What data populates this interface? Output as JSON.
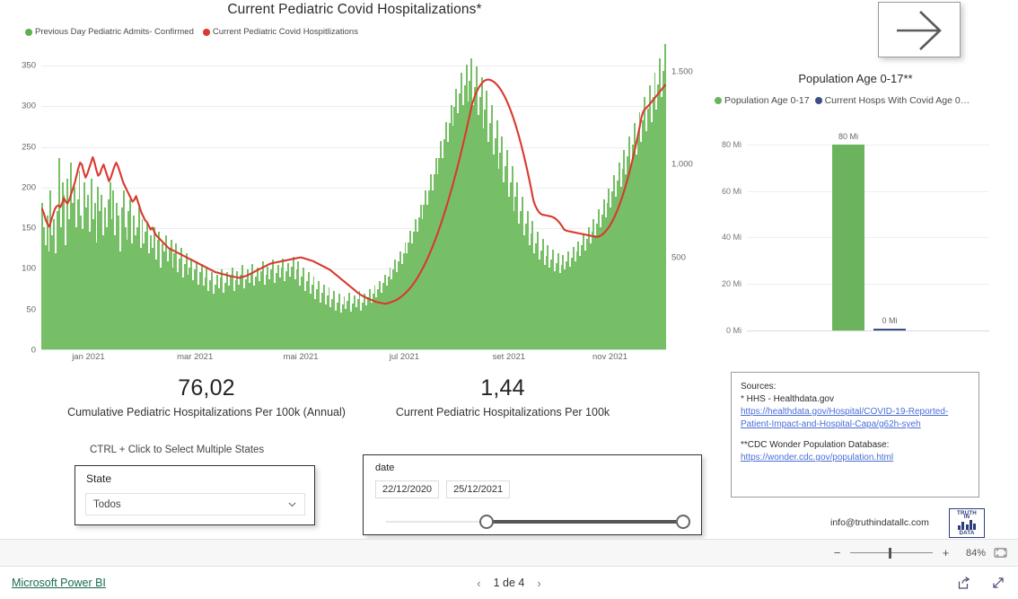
{
  "main_chart": {
    "title": "Current Pediatric Covid Hospitalizations*",
    "legend": [
      {
        "label": "Previous Day Pediatric Admits- Confirmed",
        "color": "#5ead4e"
      },
      {
        "label": "Current Pediatric Covid Hospitlizations",
        "color": "#d9392f"
      }
    ]
  },
  "kpi1": {
    "value": "76,02",
    "label": "Cumulative Pediatric Hospitalizations Per 100k (Annual)"
  },
  "kpi2": {
    "value": "1,44",
    "label": "Current Pediatric Hospitalizations Per 100k"
  },
  "state_slicer": {
    "hint": "CTRL + Click to Select Multiple States",
    "title": "State",
    "value": "Todos"
  },
  "date_slicer": {
    "title": "date",
    "start": "22/12/2020",
    "end": "25/12/2021"
  },
  "population_chart": {
    "title": "Population Age 0-17**",
    "legend": [
      {
        "label": "Population Age 0-17",
        "color": "#6cb35e"
      },
      {
        "label": "Current Hosps With Covid Age 0…",
        "color": "#3b4e87"
      }
    ]
  },
  "sources": {
    "heading": "Sources:",
    "line1": "* HHS - Healthdata.gov",
    "link1a": "https://healthdata.gov/Hospital/COVID-19-Reported-",
    "link1b": "Patient-Impact-and-Hospital-Capa/g62h-syeh",
    "line2": "**CDC Wonder Population Database:",
    "link2": "https://wonder.cdc.gov/population.html"
  },
  "footer": {
    "contact": "info@truthindatallc.com",
    "logo_top": "TRUTH",
    "logo_mid": "IN",
    "logo_bottom": "DATA"
  },
  "zoombar": {
    "minus": "−",
    "plus": "+",
    "percent": "84%"
  },
  "statusbar": {
    "brand": "Microsoft Power BI",
    "page": "1 de 4",
    "prev": "‹",
    "next": "›"
  },
  "chart_data": {
    "type": "bar",
    "title": "Current Pediatric Covid Hospitalizations*",
    "xlabel": "",
    "ylabel": "",
    "grid": true,
    "legend_position": "top-left",
    "xtick_labels": [
      "jan 2021",
      "mar 2021",
      "mai 2021",
      "jul 2021",
      "set 2021",
      "nov 2021"
    ],
    "xtick_positions_pct": [
      5.2,
      22.0,
      39.0,
      56.0,
      72.5,
      88.5
    ],
    "y_left": {
      "ticks": [
        0,
        50,
        100,
        150,
        200,
        250,
        300,
        350
      ],
      "range": [
        0,
        370
      ]
    },
    "y_right": {
      "ticks": [
        500,
        1000,
        1500
      ],
      "tick_labels": [
        "500",
        "1.000",
        "1.500"
      ],
      "range": [
        0,
        1620
      ]
    },
    "series": [
      {
        "name": "Previous Day Pediatric Admits- Confirmed",
        "type": "bar",
        "axis": "left",
        "color": "#77bf66",
        "values": [
          180,
          150,
          128,
          165,
          120,
          195,
          140,
          160,
          118,
          170,
          235,
          150,
          205,
          190,
          128,
          210,
          160,
          230,
          180,
          200,
          150,
          185,
          220,
          165,
          148,
          205,
          175,
          190,
          145,
          210,
          160,
          180,
          132,
          200,
          170,
          190,
          140,
          175,
          150,
          185,
          205,
          160,
          195,
          140,
          180,
          165,
          120,
          175,
          195,
          150,
          135,
          170,
          185,
          130,
          165,
          140,
          150,
          175,
          125,
          160,
          130,
          145,
          155,
          118,
          140,
          125,
          150,
          110,
          135,
          145,
          100,
          130,
          120,
          140,
          108,
          125,
          135,
          100,
          118,
          130,
          95,
          112,
          125,
          88,
          105,
          118,
          92,
          100,
          112,
          85,
          98,
          108,
          80,
          95,
          105,
          78,
          88,
          100,
          72,
          85,
          95,
          68,
          80,
          92,
          75,
          88,
          98,
          70,
          82,
          95,
          78,
          90,
          100,
          72,
          85,
          96,
          80,
          92,
          104,
          75,
          86,
          98,
          82,
          94,
          105,
          78,
          90,
          100,
          84,
          96,
          108,
          80,
          92,
          102,
          86,
          98,
          110,
          82,
          94,
          104,
          88,
          100,
          112,
          84,
          96,
          106,
          90,
          102,
          114,
          86,
          98,
          108,
          78,
          90,
          100,
          72,
          84,
          95,
          68,
          80,
          90,
          62,
          74,
          84,
          58,
          70,
          80,
          55,
          66,
          76,
          52,
          62,
          72,
          48,
          58,
          68,
          45,
          55,
          65,
          50,
          60,
          70,
          46,
          56,
          66,
          52,
          62,
          72,
          48,
          58,
          68,
          54,
          64,
          74,
          58,
          68,
          78,
          64,
          74,
          84,
          70,
          82,
          92,
          78,
          90,
          100,
          86,
          98,
          110,
          95,
          108,
          120,
          105,
          118,
          132,
          118,
          132,
          146,
          130,
          145,
          160,
          145,
          162,
          178,
          160,
          178,
          196,
          178,
          196,
          215,
          196,
          215,
          235,
          215,
          235,
          256,
          235,
          258,
          280,
          255,
          278,
          300,
          275,
          298,
          320,
          290,
          315,
          340,
          300,
          325,
          350,
          305,
          330,
          358,
          300,
          322,
          348,
          288,
          310,
          335,
          272,
          295,
          318,
          255,
          278,
          300,
          240,
          260,
          282,
          222,
          242,
          262,
          205,
          225,
          245,
          188,
          205,
          225,
          170,
          188,
          205,
          155,
          170,
          188,
          140,
          155,
          170,
          128,
          142,
          158,
          118,
          130,
          145,
          110,
          122,
          136,
          104,
          115,
          128,
          100,
          110,
          123,
          96,
          106,
          118,
          94,
          104,
          116,
          98,
          108,
          120,
          102,
          113,
          126,
          108,
          120,
          133,
          115,
          128,
          142,
          122,
          136,
          150,
          130,
          145,
          160,
          140,
          155,
          172,
          150,
          166,
          184,
          162,
          180,
          198,
          175,
          194,
          214,
          188,
          208,
          230,
          200,
          222,
          245,
          215,
          238,
          262,
          228,
          252,
          278,
          240,
          266,
          292,
          255,
          282,
          310,
          268,
          296,
          325,
          280,
          310,
          340,
          295,
          326,
          358,
          310,
          342,
          376
        ]
      },
      {
        "name": "Current Pediatric Covid Hospitlizations",
        "type": "line",
        "axis": "right",
        "color": "#d9392f",
        "values": [
          760,
          735,
          700,
          680,
          665,
          700,
          730,
          760,
          775,
          780,
          770,
          790,
          820,
          800,
          790,
          810,
          840,
          870,
          900,
          940,
          980,
          1010,
          1000,
          960,
          930,
          950,
          980,
          1010,
          1040,
          1010,
          970,
          940,
          950,
          980,
          1000,
          970,
          940,
          910,
          930,
          960,
          990,
          1010,
          990,
          960,
          930,
          900,
          880,
          860,
          840,
          820,
          800,
          810,
          830,
          800,
          770,
          740,
          720,
          700,
          690,
          670,
          650,
          660,
          640,
          620,
          610,
          600,
          590,
          580,
          570,
          560,
          550,
          545,
          540,
          535,
          530,
          525,
          520,
          515,
          510,
          505,
          500,
          495,
          490,
          485,
          480,
          475,
          470,
          465,
          460,
          455,
          450,
          445,
          440,
          435,
          430,
          425,
          420,
          418,
          415,
          412,
          410,
          408,
          405,
          402,
          400,
          398,
          396,
          394,
          392,
          390,
          392,
          395,
          398,
          400,
          405,
          410,
          415,
          420,
          425,
          430,
          435,
          440,
          445,
          450,
          455,
          460,
          465,
          468,
          470,
          472,
          474,
          476,
          478,
          480,
          482,
          484,
          486,
          488,
          490,
          492,
          494,
          496,
          498,
          500,
          498,
          495,
          492,
          489,
          486,
          483,
          480,
          475,
          470,
          465,
          460,
          455,
          450,
          445,
          440,
          435,
          428,
          420,
          412,
          404,
          396,
          388,
          380,
          372,
          364,
          356,
          348,
          340,
          332,
          324,
          316,
          308,
          300,
          295,
          290,
          285,
          280,
          276,
          272,
          268,
          264,
          260,
          258,
          256,
          254,
          252,
          250,
          252,
          255,
          258,
          262,
          266,
          270,
          276,
          282,
          290,
          298,
          306,
          316,
          326,
          338,
          350,
          364,
          378,
          394,
          410,
          428,
          446,
          466,
          486,
          508,
          530,
          554,
          578,
          604,
          630,
          658,
          686,
          716,
          746,
          778,
          810,
          844,
          878,
          914,
          950,
          988,
          1026,
          1066,
          1106,
          1148,
          1190,
          1234,
          1278,
          1324,
          1352,
          1380,
          1400,
          1418,
          1432,
          1444,
          1452,
          1456,
          1458,
          1456,
          1452,
          1446,
          1438,
          1428,
          1416,
          1402,
          1386,
          1368,
          1348,
          1326,
          1302,
          1276,
          1248,
          1218,
          1186,
          1152,
          1116,
          1078,
          1038,
          996,
          952,
          906,
          858,
          808,
          780,
          760,
          745,
          735,
          730,
          728,
          726,
          724,
          722,
          720,
          716,
          710,
          702,
          692,
          680,
          666,
          650,
          645,
          642,
          640,
          638,
          636,
          634,
          632,
          630,
          628,
          626,
          624,
          622,
          620,
          618,
          616,
          614,
          612,
          610,
          612,
          616,
          622,
          630,
          640,
          652,
          666,
          682,
          700,
          720,
          742,
          766,
          792,
          820,
          850,
          882,
          916,
          952,
          990,
          1030,
          1072,
          1116,
          1162,
          1210,
          1260,
          1288,
          1300,
          1310,
          1320,
          1332,
          1344,
          1356,
          1368,
          1380,
          1392,
          1404,
          1416,
          1428
        ]
      }
    ]
  },
  "population_chart_data": {
    "type": "bar",
    "title": "Population Age 0-17**",
    "categories": [
      "Population Age 0-17",
      "Current Hosps With Covid Age 0…"
    ],
    "values": [
      80,
      0
    ],
    "value_labels": [
      "80 Mi",
      "0 Mi"
    ],
    "colors": [
      "#6cb35e",
      "#3b4e87"
    ],
    "ylim": [
      0,
      88
    ],
    "ytick_labels": [
      "0 Mi",
      "20 Mi",
      "40 Mi",
      "60 Mi",
      "80 Mi"
    ],
    "ytick_values": [
      0,
      20,
      40,
      60,
      80
    ]
  }
}
